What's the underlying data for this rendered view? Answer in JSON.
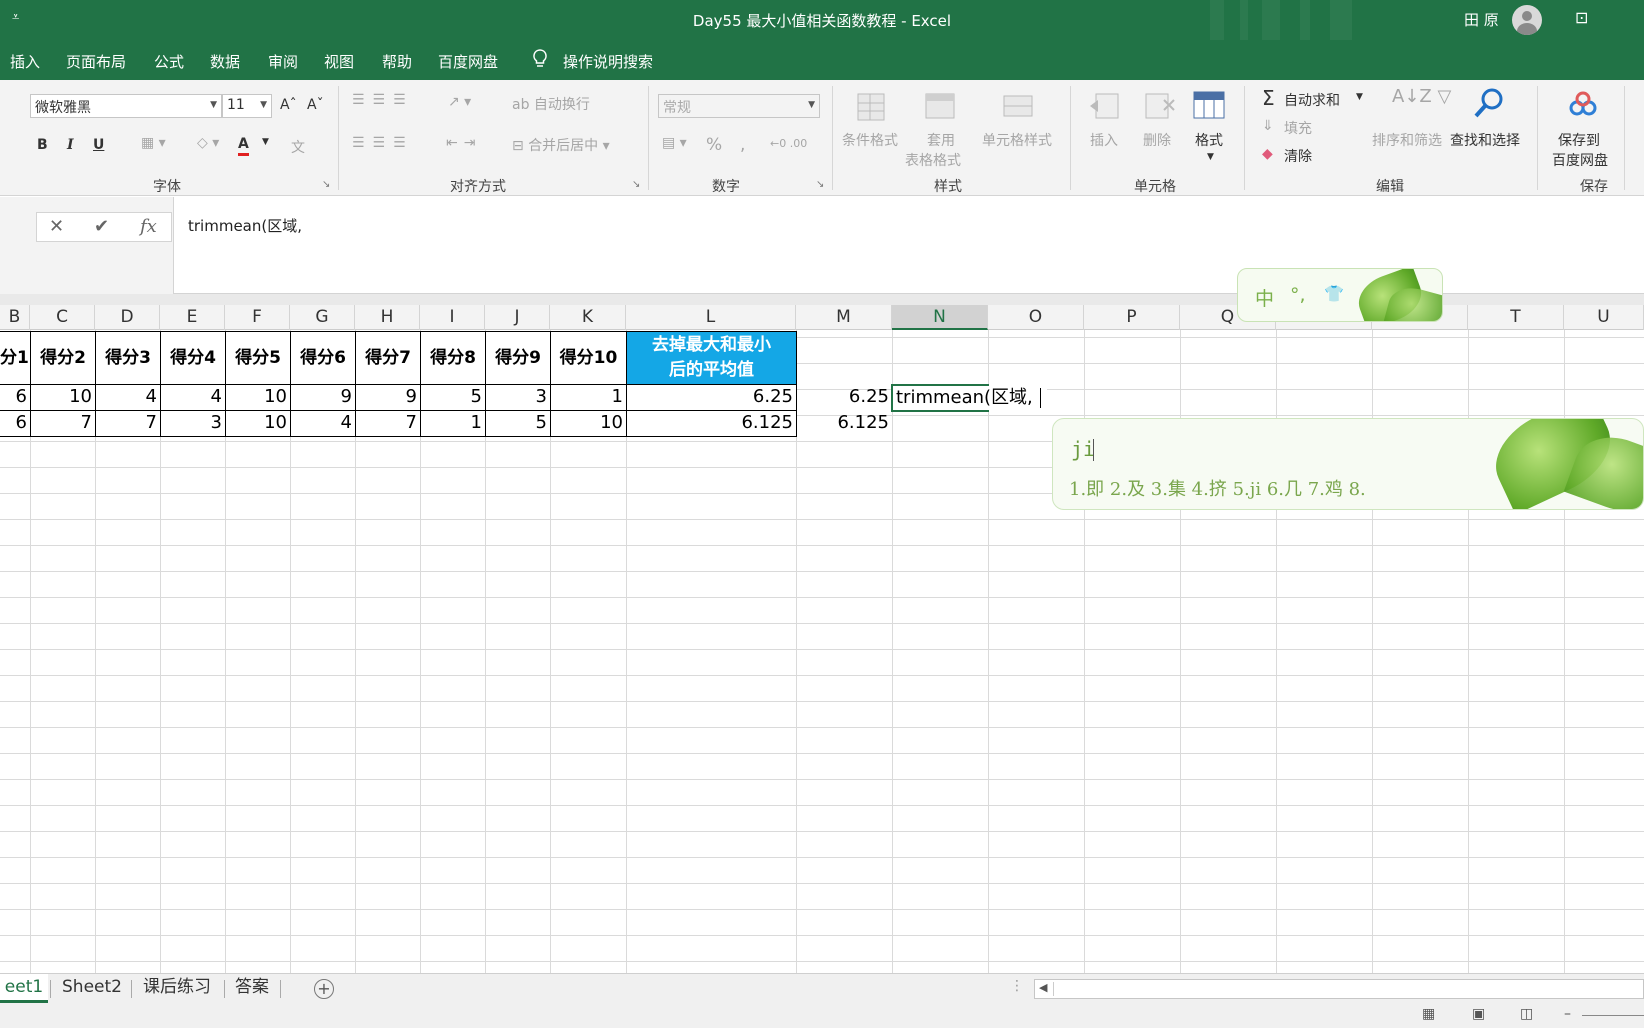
{
  "window": {
    "title": "Day55 最大小值相关函数教程 - Excel",
    "user": "田 原",
    "quick_access": "⩡",
    "ribbon_options": "⊡"
  },
  "ribbon_tabs": [
    "插入",
    "页面布局",
    "公式",
    "数据",
    "审阅",
    "视图",
    "帮助",
    "百度网盘",
    "操作说明搜索"
  ],
  "ribbon": {
    "font": {
      "name": "微软雅黑",
      "size": "11",
      "grow": "Aˆ",
      "shrink": "Aˇ",
      "bold": "B",
      "italic": "I",
      "underline": "U",
      "font_color": "A",
      "phonetic": "文",
      "label": "字体"
    },
    "alignment": {
      "wrap": "自动换行",
      "merge": "合并后居中",
      "label": "对齐方式"
    },
    "number": {
      "format": "常规",
      "percent": "%",
      "comma": ",",
      "label": "数字"
    },
    "styles": {
      "conditional": "条件格式",
      "table_1": "套用",
      "table_2": "表格格式",
      "cell_styles": "单元格样式",
      "label": "样式"
    },
    "cells": {
      "insert": "插入",
      "delete": "删除",
      "format": "格式",
      "label": "单元格"
    },
    "editing": {
      "autosum": "自动求和",
      "fill": "填充",
      "clear": "清除",
      "sort": "排序和筛选",
      "find": "查找和选择",
      "label": "编辑"
    },
    "save": {
      "line1": "保存到",
      "line2": "百度网盘",
      "label": "保存"
    }
  },
  "formula_bar": {
    "cancel": "✕",
    "enter": "✔",
    "fx": "fx",
    "content": "trimmean(区域,"
  },
  "columns": [
    "B",
    "C",
    "D",
    "E",
    "F",
    "G",
    "H",
    "I",
    "J",
    "K",
    "L",
    "M",
    "N",
    "O",
    "P",
    "Q",
    "R",
    "S",
    "T",
    "U"
  ],
  "table": {
    "headers": [
      "分1",
      "得分2",
      "得分3",
      "得分4",
      "得分5",
      "得分6",
      "得分7",
      "得分8",
      "得分9",
      "得分10"
    ],
    "result_header_line1": "去掉最大和最小",
    "result_header_line2": "后的平均值",
    "rows": [
      {
        "scores": [
          "6",
          "10",
          "4",
          "4",
          "10",
          "9",
          "9",
          "5",
          "3",
          "1"
        ],
        "result": "6.25",
        "m": "6.25"
      },
      {
        "scores": [
          "6",
          "7",
          "7",
          "3",
          "10",
          "4",
          "7",
          "1",
          "5",
          "10"
        ],
        "result": "6.125",
        "m": "6.125"
      }
    ],
    "editing_cell": "trimmean(区域,"
  },
  "ime": {
    "status": [
      "中",
      "°,",
      "👕"
    ],
    "pinyin": "ji",
    "candidates": "1.即  2.及  3.集  4.挤  5.ji  6.几  7.鸡  8."
  },
  "sheet_tabs": [
    "eet1",
    "Sheet2",
    "课后练习",
    "答案"
  ],
  "add_sheet": "+",
  "status_icons": [
    "▦",
    "▣",
    "◫",
    "–"
  ]
}
